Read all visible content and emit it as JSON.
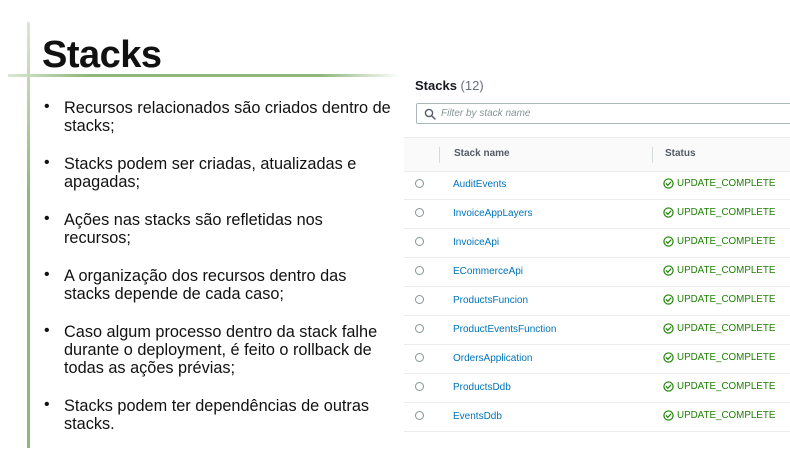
{
  "slide": {
    "title": "Stacks",
    "bullets": [
      "Recursos relacionados são criados dentro de stacks;",
      "Stacks podem ser criadas, atualizadas e apagadas;",
      "Ações nas stacks são refletidas nos recursos;",
      "A organização dos recursos dentro das stacks depende de cada caso;",
      "Caso algum processo dentro da stack falhe durante o deployment, é feito o rollback de todas as ações prévias;",
      "Stacks podem ter dependências de outras stacks."
    ],
    "accent_color": "#8fb87e"
  },
  "console": {
    "title": "Stacks",
    "count": "(12)",
    "search": {
      "placeholder": "Filter by stack name",
      "value": ""
    },
    "columns": {
      "name": "Stack name",
      "status": "Status"
    },
    "status_color": "#1d8102",
    "link_color": "#0073bb",
    "rows": [
      {
        "name": "AuditEvents",
        "status": "UPDATE_COMPLETE"
      },
      {
        "name": "InvoiceAppLayers",
        "status": "UPDATE_COMPLETE"
      },
      {
        "name": "InvoiceApi",
        "status": "UPDATE_COMPLETE"
      },
      {
        "name": "ECommerceApi",
        "status": "UPDATE_COMPLETE"
      },
      {
        "name": "ProductsFuncion",
        "status": "UPDATE_COMPLETE"
      },
      {
        "name": "ProductEventsFunction",
        "status": "UPDATE_COMPLETE"
      },
      {
        "name": "OrdersApplication",
        "status": "UPDATE_COMPLETE"
      },
      {
        "name": "ProductsDdb",
        "status": "UPDATE_COMPLETE"
      },
      {
        "name": "EventsDdb",
        "status": "UPDATE_COMPLETE"
      }
    ]
  }
}
